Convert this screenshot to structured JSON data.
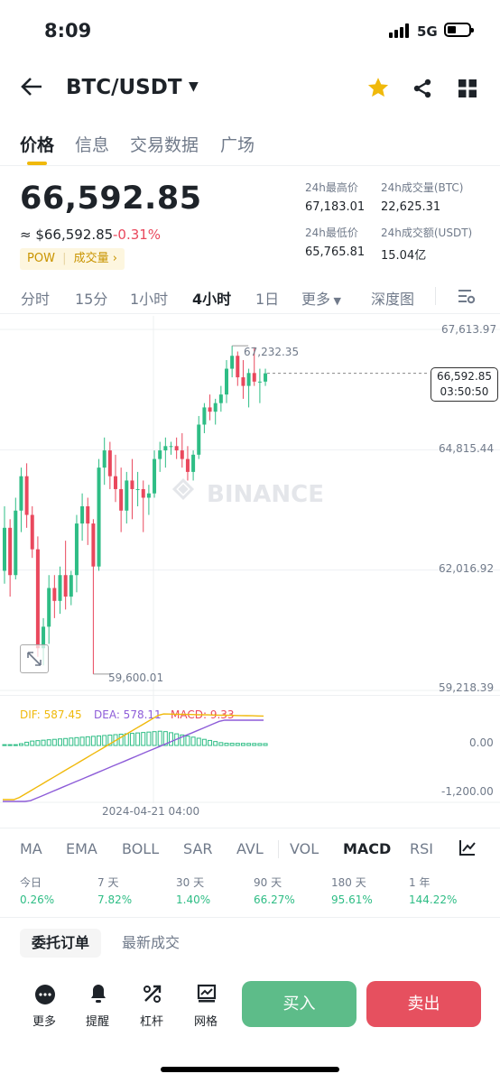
{
  "status_bar": {
    "time": "8:09",
    "network": "5G"
  },
  "header": {
    "pair": "BTC/USDT"
  },
  "tabs": [
    "价格",
    "信息",
    "交易数据",
    "广场"
  ],
  "price": {
    "last": "66,592.85",
    "usd": "≈ $66,592.85",
    "change": "-0.31%",
    "pow_tag": "POW",
    "volume_tag": "成交量 ›"
  },
  "stats": {
    "high_label": "24h最高价",
    "high": "67,183.01",
    "vol_btc_label": "24h成交量(BTC)",
    "vol_btc": "22,625.31",
    "low_label": "24h最低价",
    "low": "65,765.81",
    "vol_usdt_label": "24h成交额(USDT)",
    "vol_usdt": "15.04亿"
  },
  "intervals": [
    "分时",
    "15分",
    "1小时",
    "4小时",
    "1日",
    "更多",
    "深度图"
  ],
  "active_interval": "4小时",
  "chart": {
    "axis_labels": [
      "67,613.97",
      "64,815.44",
      "62,016.92",
      "59,218.39"
    ],
    "high_marker": "67,232.35",
    "low_marker": "59,600.01",
    "current_price": "66,592.85",
    "countdown": "03:50:50",
    "watermark": "BINANCE",
    "date_label": "2024-04-21 04:00",
    "macd": {
      "dif": "DIF: 587.45",
      "dea": "DEA: 578.11",
      "macd": "MACD: 9.33",
      "axis_zero": "0.00",
      "axis_min": "-1,200.00"
    },
    "colors": {
      "up": "#2ebd85",
      "down": "#e9485d",
      "dif": "#f0b90b",
      "dea": "#8d5cd8"
    }
  },
  "chart_data": {
    "type": "candlestick",
    "y_unit": "USDT",
    "ylim": [
      59218.39,
      67613.97
    ],
    "candles": [
      {
        "o": 62000,
        "h": 63500,
        "l": 61700,
        "c": 63000
      },
      {
        "o": 63000,
        "h": 63200,
        "l": 61400,
        "c": 61900
      },
      {
        "o": 61900,
        "h": 63700,
        "l": 61800,
        "c": 63400
      },
      {
        "o": 63400,
        "h": 64400,
        "l": 62900,
        "c": 64200
      },
      {
        "o": 64200,
        "h": 64500,
        "l": 63000,
        "c": 63300
      },
      {
        "o": 63300,
        "h": 63500,
        "l": 62300,
        "c": 62500
      },
      {
        "o": 62500,
        "h": 62800,
        "l": 60000,
        "c": 60200
      },
      {
        "o": 60200,
        "h": 60900,
        "l": 59800,
        "c": 60700
      },
      {
        "o": 60700,
        "h": 61900,
        "l": 60300,
        "c": 61600
      },
      {
        "o": 61600,
        "h": 61900,
        "l": 60900,
        "c": 61300
      },
      {
        "o": 61300,
        "h": 62100,
        "l": 61000,
        "c": 61900
      },
      {
        "o": 61900,
        "h": 62700,
        "l": 61100,
        "c": 61400
      },
      {
        "o": 61400,
        "h": 62000,
        "l": 61200,
        "c": 61900
      },
      {
        "o": 61900,
        "h": 63300,
        "l": 61500,
        "c": 63100
      },
      {
        "o": 63100,
        "h": 63800,
        "l": 62700,
        "c": 63500
      },
      {
        "o": 63500,
        "h": 63700,
        "l": 62600,
        "c": 63100
      },
      {
        "o": 63100,
        "h": 63200,
        "l": 59600.01,
        "c": 62100
      },
      {
        "o": 62100,
        "h": 64600,
        "l": 62000,
        "c": 64400
      },
      {
        "o": 64400,
        "h": 65100,
        "l": 64000,
        "c": 64800
      },
      {
        "o": 64800,
        "h": 65000,
        "l": 63900,
        "c": 64200
      },
      {
        "o": 64200,
        "h": 64700,
        "l": 63600,
        "c": 63900
      },
      {
        "o": 63900,
        "h": 64400,
        "l": 62900,
        "c": 63400
      },
      {
        "o": 63400,
        "h": 64300,
        "l": 63100,
        "c": 64100
      },
      {
        "o": 64100,
        "h": 64600,
        "l": 63200,
        "c": 63900
      },
      {
        "o": 63900,
        "h": 64300,
        "l": 63500,
        "c": 63900
      },
      {
        "o": 63900,
        "h": 64100,
        "l": 62900,
        "c": 63700
      },
      {
        "o": 63700,
        "h": 64000,
        "l": 63300,
        "c": 63800
      },
      {
        "o": 63800,
        "h": 64800,
        "l": 63700,
        "c": 64600
      },
      {
        "o": 64600,
        "h": 65000,
        "l": 64300,
        "c": 64800
      },
      {
        "o": 64800,
        "h": 65100,
        "l": 64400,
        "c": 64900
      },
      {
        "o": 64900,
        "h": 65000,
        "l": 64700,
        "c": 64900
      },
      {
        "o": 64900,
        "h": 65100,
        "l": 64600,
        "c": 64800
      },
      {
        "o": 64800,
        "h": 65200,
        "l": 64400,
        "c": 64600
      },
      {
        "o": 64600,
        "h": 64900,
        "l": 64100,
        "c": 64300
      },
      {
        "o": 64300,
        "h": 64800,
        "l": 64100,
        "c": 64700
      },
      {
        "o": 64700,
        "h": 65600,
        "l": 64600,
        "c": 65400
      },
      {
        "o": 65400,
        "h": 65900,
        "l": 65200,
        "c": 65800
      },
      {
        "o": 65800,
        "h": 66100,
        "l": 65500,
        "c": 65700
      },
      {
        "o": 65700,
        "h": 66000,
        "l": 65400,
        "c": 65900
      },
      {
        "o": 65900,
        "h": 66300,
        "l": 65700,
        "c": 66100
      },
      {
        "o": 66100,
        "h": 66900,
        "l": 65900,
        "c": 66700
      },
      {
        "o": 66700,
        "h": 67232.35,
        "l": 66500,
        "c": 67000
      },
      {
        "o": 67000,
        "h": 67100,
        "l": 66300,
        "c": 66500
      },
      {
        "o": 66500,
        "h": 66900,
        "l": 66000,
        "c": 66300
      },
      {
        "o": 66300,
        "h": 66700,
        "l": 65800,
        "c": 66600
      },
      {
        "o": 66600,
        "h": 67200,
        "l": 66300,
        "c": 66400
      },
      {
        "o": 66400,
        "h": 66700,
        "l": 65900,
        "c": 66400
      },
      {
        "o": 66400,
        "h": 66700,
        "l": 66300,
        "c": 66592.85
      }
    ]
  },
  "indicators": [
    "MA",
    "EMA",
    "BOLL",
    "SAR",
    "AVL",
    "VOL",
    "MACD",
    "RSI"
  ],
  "active_indicator": "MACD",
  "performance": [
    {
      "label": "今日",
      "value": "0.26%"
    },
    {
      "label": "7 天",
      "value": "7.82%"
    },
    {
      "label": "30 天",
      "value": "1.40%"
    },
    {
      "label": "90 天",
      "value": "66.27%"
    },
    {
      "label": "180 天",
      "value": "95.61%"
    },
    {
      "label": "1 年",
      "value": "144.22%"
    }
  ],
  "order_tabs": [
    "委托订单",
    "最新成交"
  ],
  "bottom_actions": [
    "更多",
    "提醒",
    "杠杆",
    "网格"
  ],
  "buy_label": "买入",
  "sell_label": "卖出"
}
